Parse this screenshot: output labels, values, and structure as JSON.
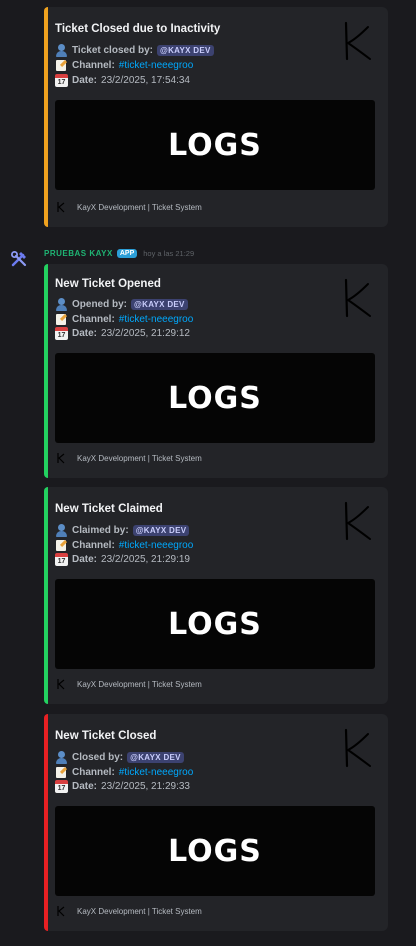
{
  "message_header": {
    "author": "PRUEBAS KAYX",
    "badge": "APP",
    "timestamp": "hoy a las 21:29",
    "avatar_icon": "hammer-wrench-icon"
  },
  "colors": {
    "orange": "#f0a21f",
    "green": "#23d160",
    "red": "#e82023"
  },
  "embeds": [
    {
      "title": "Ticket Closed due to Inactivity",
      "accent": "orange",
      "user_label": "Ticket closed by:",
      "user_value": "@KAYX DEV",
      "channel_label": "Channel:",
      "channel_value": "#ticket-neeegroo",
      "date_label": "Date:",
      "date_value": "23/2/2025, 17:54:34",
      "banner_text": "LOGS",
      "footer": "KayX Development | Ticket System"
    },
    {
      "title": "New Ticket Opened",
      "accent": "green",
      "user_label": "Opened by:",
      "user_value": "@KAYX DEV",
      "channel_label": "Channel:",
      "channel_value": "#ticket-neeegroo",
      "date_label": "Date:",
      "date_value": "23/2/2025, 21:29:12",
      "banner_text": "LOGS",
      "footer": "KayX Development | Ticket System"
    },
    {
      "title": "New Ticket Claimed",
      "accent": "green",
      "user_label": "Claimed by:",
      "user_value": "@KAYX DEV",
      "channel_label": "Channel:",
      "channel_value": "#ticket-neeegroo",
      "date_label": "Date:",
      "date_value": "23/2/2025, 21:29:19",
      "banner_text": "LOGS",
      "footer": "KayX Development | Ticket System"
    },
    {
      "title": "New Ticket Closed",
      "accent": "red",
      "user_label": "Closed by:",
      "user_value": "@KAYX DEV",
      "channel_label": "Channel:",
      "channel_value": "#ticket-neeegroo",
      "date_label": "Date:",
      "date_value": "23/2/2025, 21:29:33",
      "banner_text": "LOGS",
      "footer": "KayX Development | Ticket System"
    }
  ]
}
